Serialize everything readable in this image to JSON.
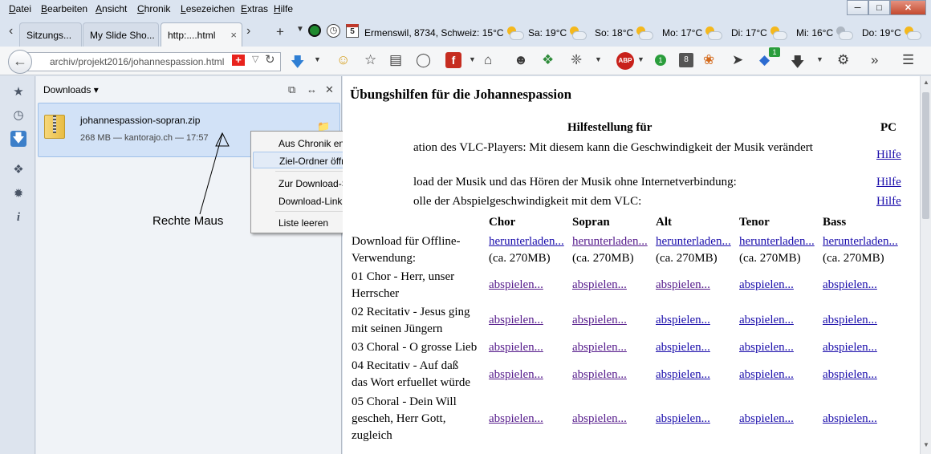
{
  "menu": [
    "Datei",
    "Bearbeiten",
    "Ansicht",
    "Chronik",
    "Lesezeichen",
    "Extras",
    "Hilfe"
  ],
  "tabs": [
    {
      "label": "Sitzungs..."
    },
    {
      "label": "My Slide Sho..."
    },
    {
      "label": "http:....html",
      "close": "×"
    }
  ],
  "weather": {
    "location": "Ermenswil, 8734, Schweiz: 15°C",
    "days": [
      "Sa: 19°C",
      "So: 18°C",
      "Mo: 17°C",
      "Di: 17°C",
      "Mi: 16°C",
      "Do: 19°C"
    ],
    "calendar_day": "5"
  },
  "nav": {
    "url": "archiv/projekt2016/johannespassion.html",
    "abp_badge": "ABP",
    "badge1": "1",
    "badge8": "8"
  },
  "downloads_panel": {
    "title": "Downloads",
    "item": {
      "name": "johannespassion-sopran.zip",
      "meta": "268 MB — kantorajo.ch — 17:57"
    },
    "annotation": "Rechte Maus"
  },
  "context_menu": {
    "items": [
      "Aus Chronik entfernen",
      "Ziel-Ordner öffnen",
      "Zur Download-Seite gehen",
      "Download-Link kopieren",
      "Liste leeren"
    ]
  },
  "page": {
    "title": "Übungshilfen für die Johannespassion",
    "hilfe_header": "Hilfestellung für",
    "pc_header": "PC",
    "help_rows": [
      {
        "text": "ation des VLC-Players: Mit diesem kann die Geschwindigkeit der Musik verändert",
        "link": "Hilfe"
      },
      {
        "text": "load der Musik und das Hören der Musik ohne Internetverbindung:",
        "link": "Hilfe"
      },
      {
        "text": "olle der Abspielgeschwindigkeit mit dem VLC:",
        "link": "Hilfe"
      }
    ],
    "voices": [
      "Chor",
      "Sopran",
      "Alt",
      "Tenor",
      "Bass"
    ],
    "offline_label": [
      "Download für Offline-",
      "Verwendung:"
    ],
    "download_link": "herunterladen...",
    "download_size": "(ca. 270MB)",
    "play_link": "abspielen...",
    "pieces": [
      [
        "01 Chor - Herr, unser",
        "Herrscher"
      ],
      [
        "02 Recitativ - Jesus ging",
        "mit seinen Jüngern"
      ],
      [
        "03 Choral - O grosse Lieb"
      ],
      [
        "04 Recitativ - Auf daß",
        "das Wort erfuellet würde"
      ],
      [
        "05 Choral - Dein Will",
        "gescheh, Herr Gott,",
        "zugleich"
      ]
    ]
  }
}
